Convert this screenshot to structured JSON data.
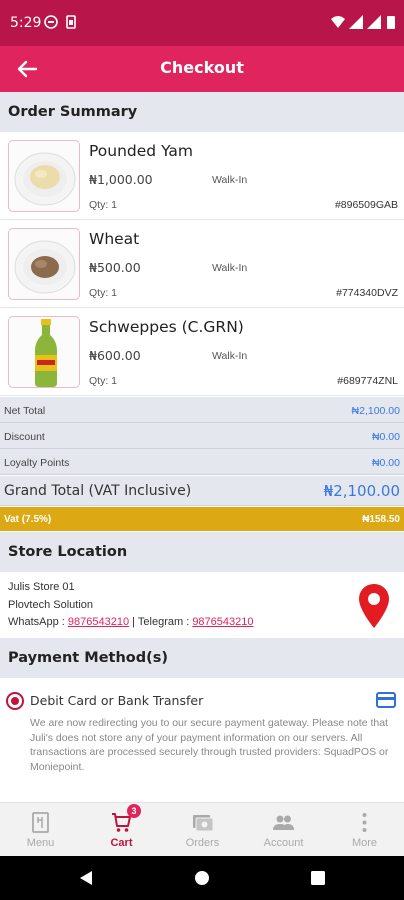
{
  "status_bar": {
    "time": "5:29",
    "icons": [
      "notification-icon",
      "sim-icon",
      "wifi-icon",
      "signal-icon",
      "signal-icon",
      "battery-icon"
    ]
  },
  "app_bar": {
    "title": "Checkout",
    "back_icon": "arrow-back-icon"
  },
  "order_summary": {
    "heading": "Order Summary",
    "items": [
      {
        "name": "Pounded Yam",
        "price": "₦1,000.00",
        "channel": "Walk-In",
        "qty": "Qty: 1",
        "ref": "#896509GAB",
        "image": "pounded-yam-plate"
      },
      {
        "name": "Wheat",
        "price": "₦500.00",
        "channel": "Walk-In",
        "qty": "Qty: 1",
        "ref": "#774340DVZ",
        "image": "wheat-plate"
      },
      {
        "name": "Schweppes (C.GRN)",
        "price": "₦600.00",
        "channel": "Walk-In",
        "qty": "Qty: 1",
        "ref": "#689774ZNL",
        "image": "schweppes-bottle"
      }
    ]
  },
  "totals": {
    "net_total_label": "Net Total",
    "net_total": "₦2,100.00",
    "discount_label": "Discount",
    "discount": "₦0.00",
    "loyalty_label": "Loyalty Points",
    "loyalty": "₦0.00",
    "grand_total_label": "Grand Total (VAT Inclusive)",
    "grand_total": "₦2,100.00",
    "vat_label": "Vat (7.5%)",
    "vat": "₦158.50"
  },
  "store_location": {
    "heading": "Store Location",
    "store_name": "Julis Store 01",
    "company": "Plovtech Solution",
    "whatsapp_label": "WhatsApp :",
    "whatsapp": "9876543210",
    "separator": "|",
    "telegram_label": "Telegram :",
    "telegram": "9876543210",
    "pin_icon": "map-pin-icon"
  },
  "payment": {
    "heading": "Payment Method(s)",
    "option_label": "Debit Card or Bank Transfer",
    "option_icon": "credit-card-icon",
    "note": "We are now redirecting you to our secure payment gateway. Please note that Juli's does not store any of your payment information on our servers. All transactions are processed securely through trusted providers: SquadPOS or Moniepoint."
  },
  "bottom_nav": {
    "items": [
      {
        "label": "Menu",
        "icon": "menu-book-icon",
        "active": false
      },
      {
        "label": "Cart",
        "icon": "cart-icon",
        "active": true,
        "badge": "3"
      },
      {
        "label": "Orders",
        "icon": "orders-icon",
        "active": false
      },
      {
        "label": "Account",
        "icon": "people-icon",
        "active": false
      },
      {
        "label": "More",
        "icon": "more-vertical-icon",
        "active": false
      }
    ]
  },
  "system_nav": {
    "icons": [
      "back-triangle-icon",
      "home-circle-icon",
      "recents-square-icon"
    ]
  },
  "colors": {
    "primary": "#e0245e",
    "status_bar": "#b8154a",
    "vat_bar": "#dca914",
    "accent_blue": "#3a78e0",
    "section_bg": "#e4e8ee"
  }
}
